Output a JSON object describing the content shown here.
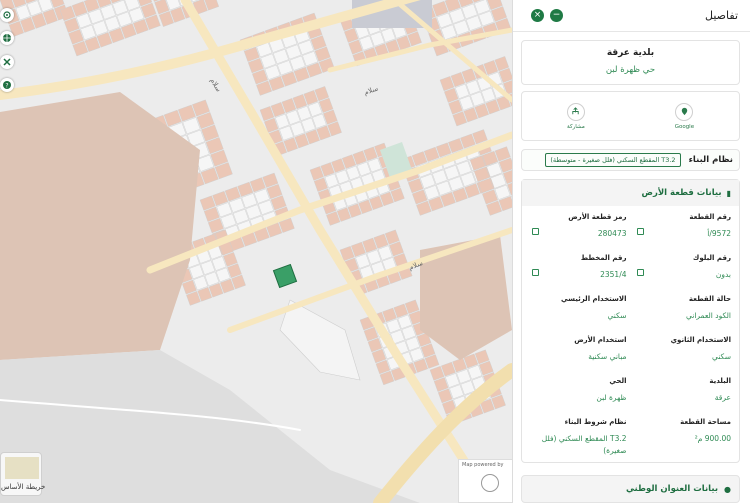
{
  "map": {
    "street_labels": [
      "سلام",
      "سلام",
      "سلام"
    ],
    "basemap_label": "خريطة الأساس",
    "minimap_label": "Map powered by",
    "colors": {
      "parcel": "#ebc7b6",
      "road": "#f7e7bf",
      "ground": "#ececec",
      "selected": "#3a9f67"
    }
  },
  "left_toolbar": [
    {
      "icon": "locate-icon"
    },
    {
      "icon": "globe-icon"
    },
    {
      "icon": "tools-icon"
    },
    {
      "icon": "help-icon"
    }
  ],
  "panel": {
    "title": "تفاصيل",
    "municipality": "بلدية عرقة",
    "district": "حي ظهرة لبن",
    "actions": [
      {
        "label": "Google",
        "icon": "map-icon"
      },
      {
        "label": "مشاركة",
        "icon": "share-icon"
      }
    ],
    "building_system": {
      "label": "نظام البناء",
      "value": "T3.2 المقطع السكني (فلل صغيرة - متوسطة)"
    },
    "plot_section": {
      "title": "بيانات قطعة الأرض",
      "rows": [
        [
          {
            "label": "رقم القطعة",
            "value": "9572/أ"
          },
          {
            "label": "رمز قطعة الأرض",
            "value": "280473"
          }
        ],
        [
          {
            "label": "رقم البلوك",
            "value": "بدون"
          },
          {
            "label": "رقم المخطط",
            "value": "2351/4"
          }
        ],
        [
          {
            "label": "حالة القطعة",
            "value": "الكود العمراني"
          },
          {
            "label": "الاستخدام الرئيسي",
            "value": "سكني"
          }
        ],
        [
          {
            "label": "الاستخدام الثانوي",
            "value": "سكني"
          },
          {
            "label": "استخدام الأرض",
            "value": "مباني سكنية"
          }
        ],
        [
          {
            "label": "البلدية",
            "value": "عرقة"
          },
          {
            "label": "الحي",
            "value": "ظهرة لبن"
          }
        ],
        [
          {
            "label": "مساحة القطعة",
            "value": "900.00 م²"
          },
          {
            "label": "نظام شروط البناء",
            "value": "T3.2 المقطع السكني (فلل صغيرة)"
          }
        ]
      ]
    },
    "address_section": {
      "title": "بيانات العنوان الوطني"
    }
  }
}
